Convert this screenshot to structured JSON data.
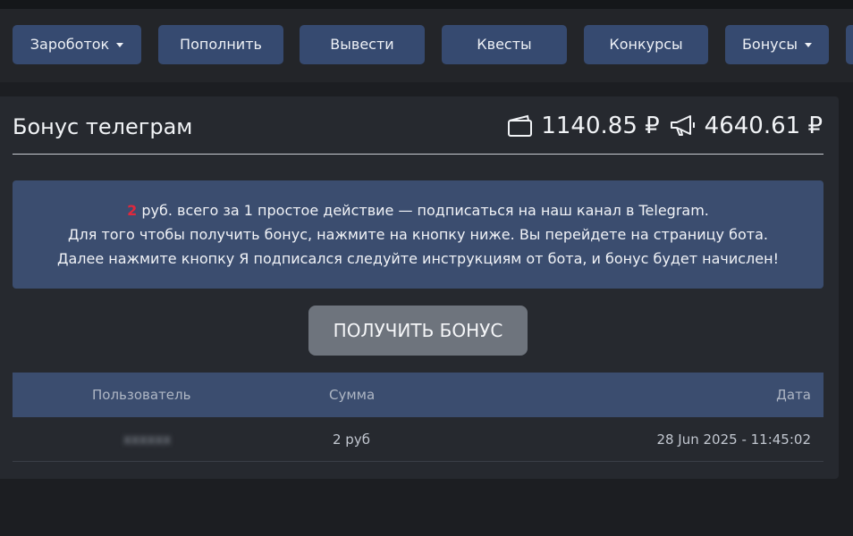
{
  "nav": {
    "items": [
      {
        "label": "Зароботок",
        "dropdown": true
      },
      {
        "label": "Пополнить",
        "dropdown": false
      },
      {
        "label": "Вывести",
        "dropdown": false
      },
      {
        "label": "Квесты",
        "dropdown": false
      },
      {
        "label": "Конкурсы",
        "dropdown": false
      },
      {
        "label": "Бонусы",
        "dropdown": true
      }
    ]
  },
  "page": {
    "title": "Бонус телеграм",
    "wallet_balance": "1140.85 ₽",
    "ads_balance": "4640.61 ₽"
  },
  "info": {
    "amount": "2",
    "line1_rest": " руб. всего за 1 простое действие — подписаться на наш канал в Telegram.",
    "line2": "Для того чтобы получить бонус, нажмите на кнопку ниже. Вы перейдете на страницу бота.",
    "line3": "Далее нажмите кнопку Я подписался следуйте инструкциям от бота, и бонус будет начислен!"
  },
  "bonus_button": "ПОЛУЧИТЬ БОНУС",
  "table": {
    "headers": {
      "user": "Пользователь",
      "amount": "Сумма",
      "date": "Дата"
    },
    "rows": [
      {
        "user": "xxxxxx",
        "amount": "2 руб",
        "date": "28 Jun 2025 - 11:45:02"
      }
    ]
  },
  "colors": {
    "accent": "#364a70",
    "highlight": "#e0283c"
  }
}
